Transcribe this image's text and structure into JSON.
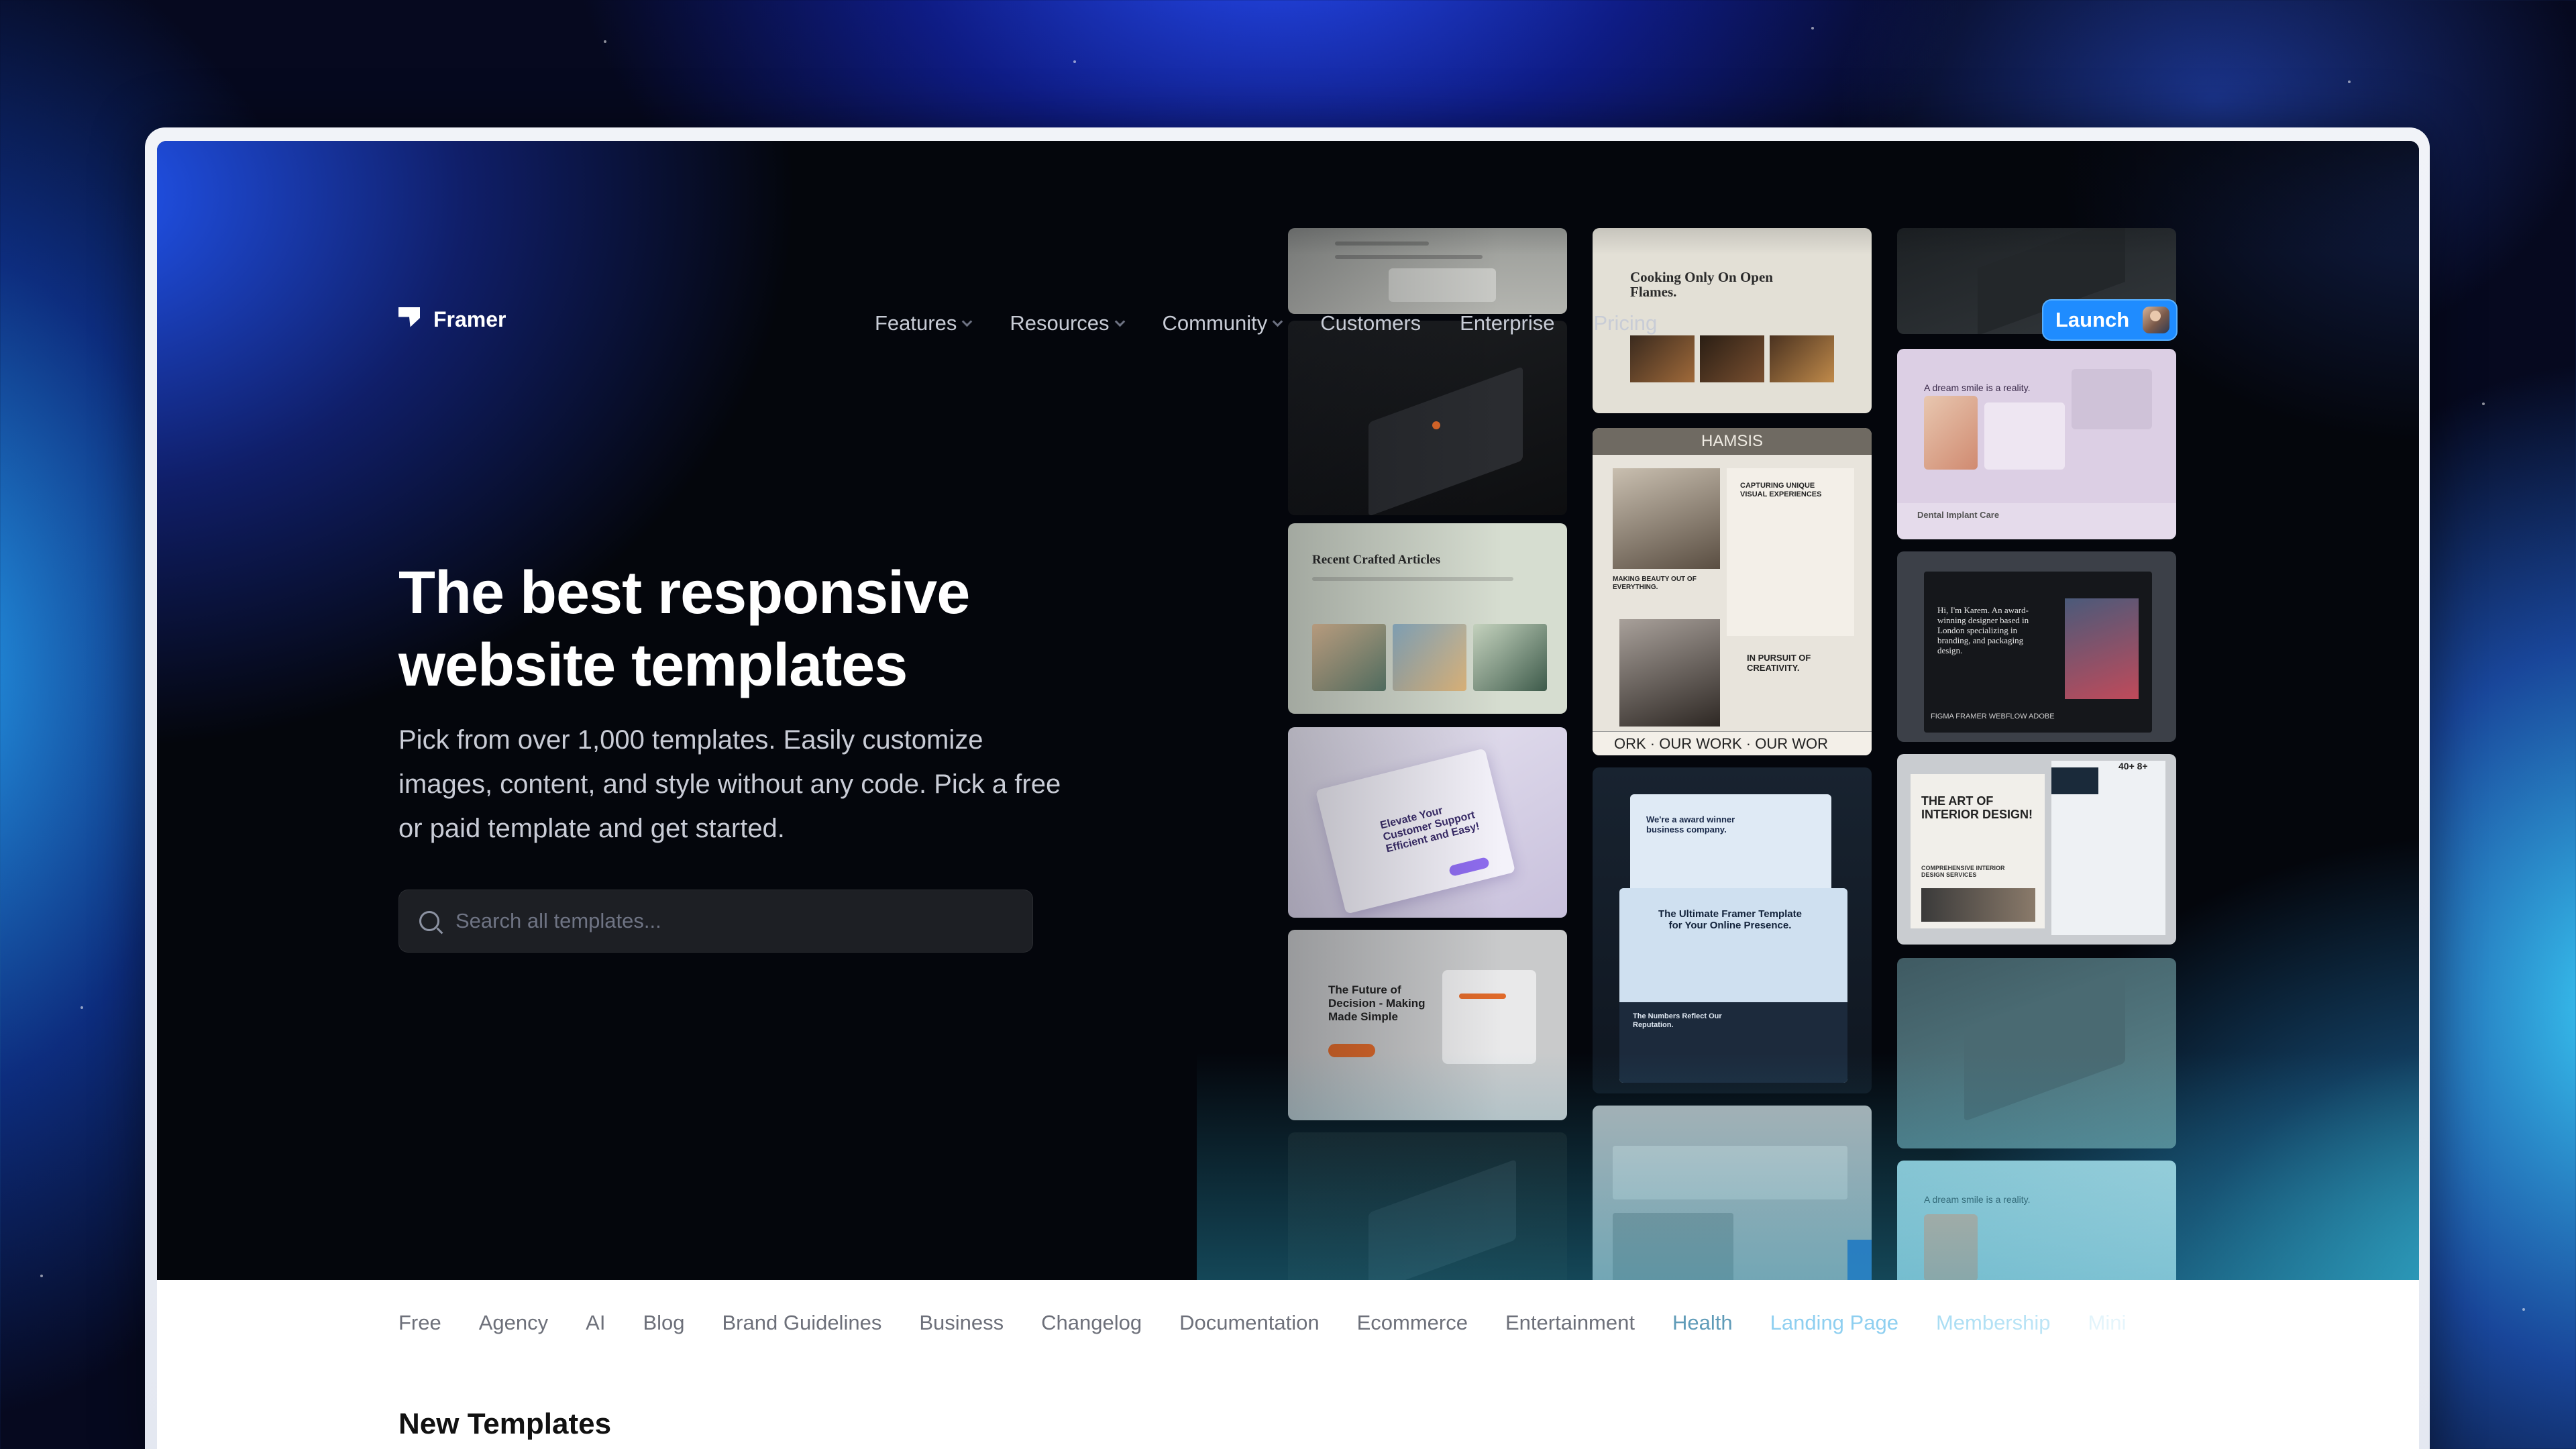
{
  "brand": {
    "name": "Framer"
  },
  "nav": {
    "items": [
      {
        "label": "Features",
        "has_dropdown": true
      },
      {
        "label": "Resources",
        "has_dropdown": true
      },
      {
        "label": "Community",
        "has_dropdown": true
      },
      {
        "label": "Customers",
        "has_dropdown": false
      },
      {
        "label": "Enterprise",
        "has_dropdown": false
      },
      {
        "label": "Pricing",
        "has_dropdown": false
      }
    ],
    "launch_label": "Launch"
  },
  "hero": {
    "title": "The best responsive website templates",
    "subtitle": "Pick from over 1,000 templates. Easily customize images, content, and style without any code. Pick a free or paid template and get started."
  },
  "search": {
    "placeholder": "Search all templates..."
  },
  "template_previews": {
    "cooking": "Cooking Only On Open Flames.",
    "articles": "Recent Crafted Articles",
    "hamsis_brand": "HAMSIS",
    "hamsis_headline": "CAPTURING UNIQUE VISUAL EXPERIENCES",
    "hamsis_beauty": "MAKING BEAUTY OUT OF EVERYTHING.",
    "hamsis_pursuit": "IN PURSUIT OF CREATIVITY.",
    "hamsis_marquee": "ORK · OUR WORK · OUR WOR",
    "dental_headline": "A dream smile is a reality.",
    "dental_service": "Dental Implant Care",
    "designer_bio": "Hi, I'm Karem. An award-winning designer based in London specializing in branding, and packaging design.",
    "designer_logos": "FIGMA  FRAMER  WEBFLOW  ADOBE",
    "support": "Elevate Your Customer Support Efficient and Easy!",
    "award_winner": "We're a award winner business company.",
    "ultimate": "The Ultimate Framer Template for Your Online Presence.",
    "numbers": "The Numbers Reflect Our Reputation.",
    "interior_a": "THE ART OF INTERIOR DESIGN!",
    "interior_b": "COMPREHENSIVE INTERIOR DESIGN SERVICES",
    "interior_stats": "40+  8+",
    "decision": "The Future of Decision - Making Made Simple",
    "dental_repeat": "A dream smile is a reality."
  },
  "categories": [
    "Free",
    "Agency",
    "AI",
    "Blog",
    "Brand Guidelines",
    "Business",
    "Changelog",
    "Documentation",
    "Ecommerce",
    "Entertainment",
    "Health",
    "Landing Page",
    "Membership",
    "Mini"
  ],
  "sections": {
    "new_templates": "New Templates"
  },
  "colors": {
    "accent": "#1F8CFF",
    "hero_bg": "#04060C",
    "page_bg": "#FFFFFF",
    "category_text": "#6D707A",
    "category_text_faded": "#8ECFF0"
  }
}
